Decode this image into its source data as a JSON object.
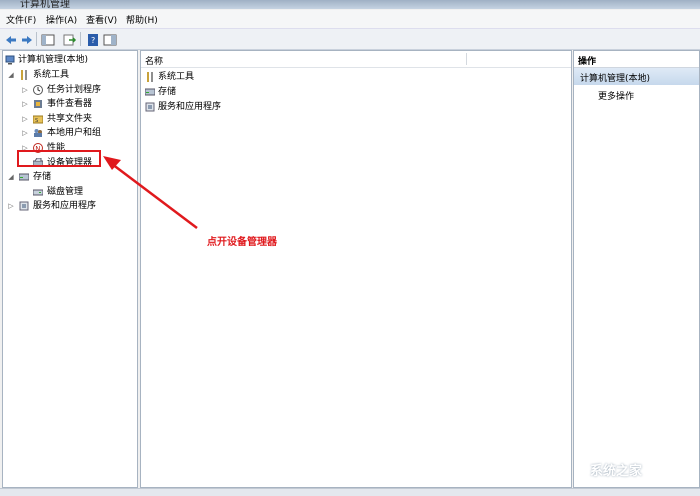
{
  "window": {
    "title": "计算机管理"
  },
  "menu": {
    "items": [
      "文件(F)",
      "操作(A)",
      "查看(V)",
      "帮助(H)"
    ]
  },
  "tree": {
    "root": "计算机管理(本地)",
    "items": [
      {
        "label": "系统工具",
        "level": 1,
        "expand": "◢"
      },
      {
        "label": "任务计划程序",
        "level": 2,
        "expand": "▷"
      },
      {
        "label": "事件查看器",
        "level": 2,
        "expand": "▷"
      },
      {
        "label": "共享文件夹",
        "level": 2,
        "expand": "▷"
      },
      {
        "label": "本地用户和组",
        "level": 2,
        "expand": "▷"
      },
      {
        "label": "性能",
        "level": 2,
        "expand": "▷"
      },
      {
        "label": "设备管理器",
        "level": 2,
        "expand": ""
      },
      {
        "label": "存储",
        "level": 1,
        "expand": "◢"
      },
      {
        "label": "磁盘管理",
        "level": 2,
        "expand": ""
      },
      {
        "label": "服务和应用程序",
        "level": 1,
        "expand": "▷"
      }
    ]
  },
  "center": {
    "column_name": "名称",
    "items": [
      "系统工具",
      "存储",
      "服务和应用程序"
    ]
  },
  "actions": {
    "header": "操作",
    "section": "计算机管理(本地)",
    "more": "更多操作"
  },
  "annotation": {
    "text": "点开设备管理器",
    "color": "#e0191d"
  },
  "watermark": {
    "text": "系统之家"
  }
}
